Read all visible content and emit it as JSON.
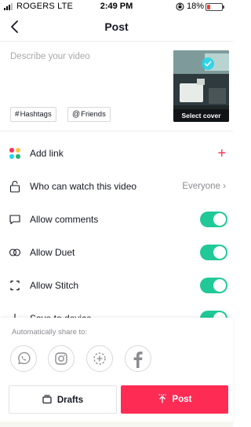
{
  "status_bar": {
    "carrier": "ROGERS  LTE",
    "time": "2:49 PM",
    "battery": "18%"
  },
  "header": {
    "title": "Post"
  },
  "caption": {
    "placeholder": "Describe your video"
  },
  "cover": {
    "label": "Select cover"
  },
  "chips": {
    "hashtags": "Hashtags",
    "friends": "Friends"
  },
  "options": {
    "add_link": "Add link",
    "who_can_watch": {
      "label": "Who can watch this video",
      "value": "Everyone"
    },
    "allow_comments": {
      "label": "Allow comments",
      "enabled": true
    },
    "allow_duet": {
      "label": "Allow Duet",
      "enabled": true
    },
    "allow_stitch": {
      "label": "Allow Stitch",
      "enabled": true
    },
    "save_to_device": {
      "label": "Save to device",
      "enabled": true
    }
  },
  "share": {
    "label": "Automatically share to:",
    "targets": [
      "whatsapp-icon",
      "instagram-icon",
      "more-share-icon",
      "facebook-icon"
    ]
  },
  "actions": {
    "drafts": "Drafts",
    "post": "Post"
  },
  "colors": {
    "accent": "#fe2c55",
    "toggle_on": "#20c997"
  }
}
